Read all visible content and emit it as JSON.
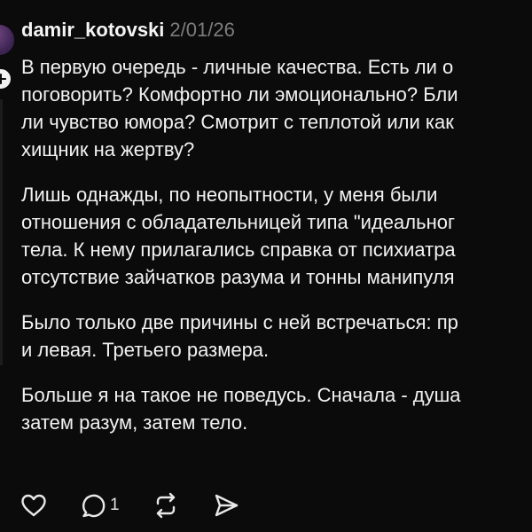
{
  "post": {
    "username": "damir_kotovski",
    "date": "2/01/26",
    "paragraphs": [
      {
        "lines": [
          "В первую очередь - личные качества. Есть ли о",
          "поговорить? Комфортно ли эмоционально? Бли",
          "ли чувство юмора? Смотрит с теплотой или как",
          "хищник на жертву?"
        ]
      },
      {
        "lines": [
          "Лишь однажды, по неопытности, у меня были",
          "отношения с обладательницей  типа \"идеальног",
          "тела. К нему прилагались справка от психиатра",
          "отсутствие зайчатков разума и тонны манипуля"
        ]
      },
      {
        "lines": [
          "Было только две причины с ней встречаться: пр",
          "и левая. Третьего размера."
        ]
      },
      {
        "lines": [
          "Больше я на такое не поведусь. Сначала - душа",
          "затем разум, затем тело."
        ]
      }
    ]
  },
  "actions": {
    "like_icon": "heart-icon",
    "reply_icon": "comment-icon",
    "reply_count": "1",
    "repost_icon": "repost-icon",
    "share_icon": "send-icon"
  },
  "colors": {
    "background": "#0b0b0b",
    "text": "#f2f2f2",
    "muted": "#7d7d7d"
  }
}
